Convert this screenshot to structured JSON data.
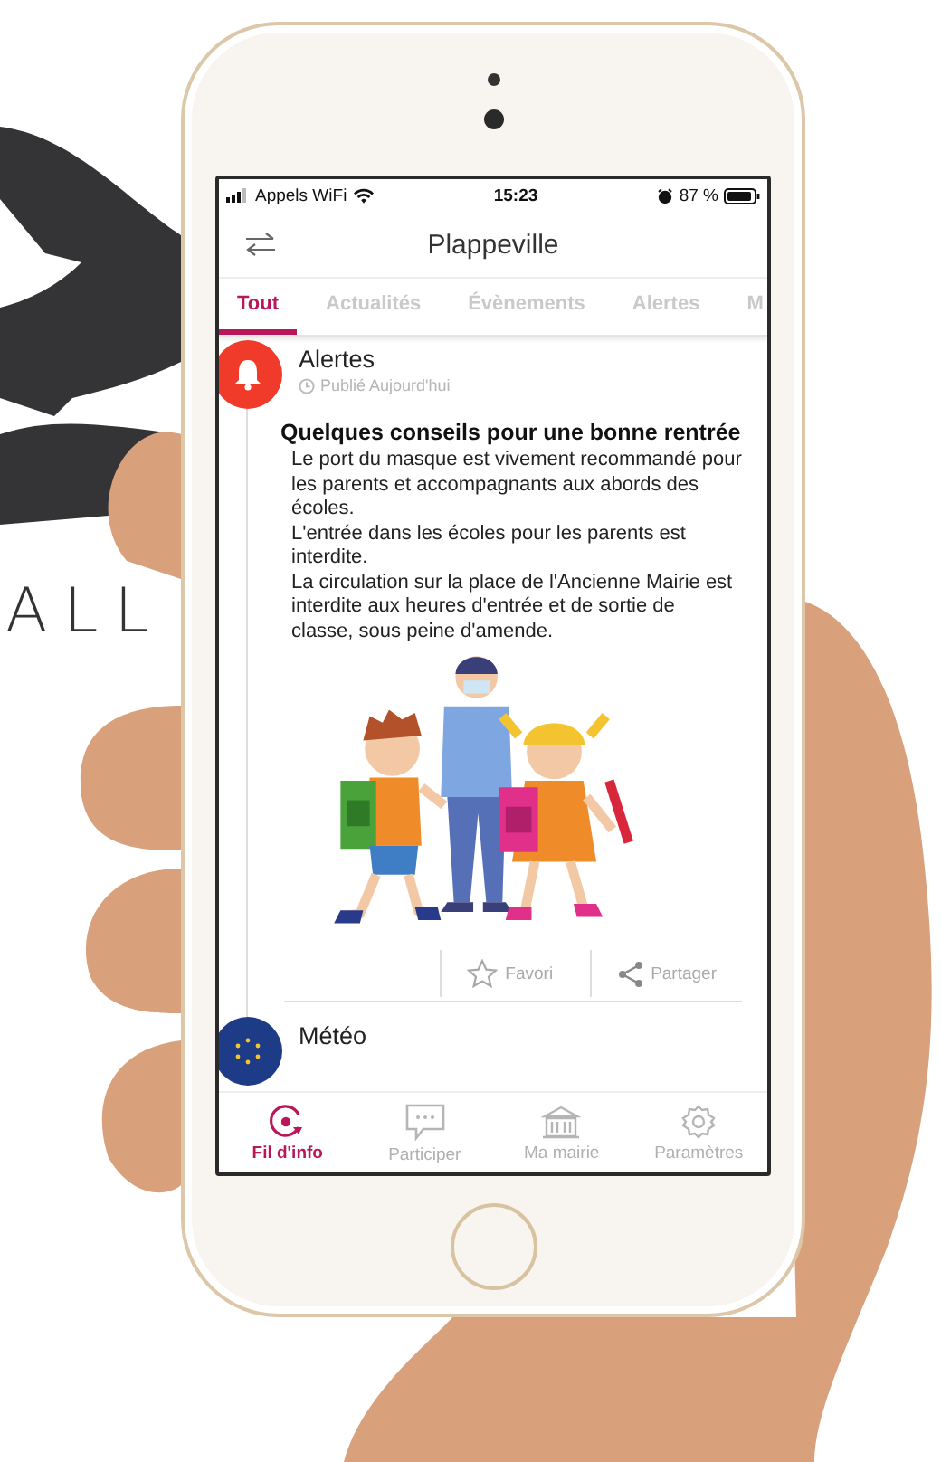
{
  "logo": {
    "text": "ALL"
  },
  "status_bar": {
    "carrier": "Appels WiFi",
    "time": "15:23",
    "battery": "87 %"
  },
  "header": {
    "title": "Plappeville"
  },
  "tabs": [
    {
      "label": "Tout",
      "selected": true
    },
    {
      "label": "Actualités",
      "selected": false
    },
    {
      "label": "Évènements",
      "selected": false
    },
    {
      "label": "Alertes",
      "selected": false
    },
    {
      "label": "M",
      "selected": false
    }
  ],
  "feed": [
    {
      "kind": "alert",
      "category": "Alertes",
      "published": "Publié Aujourd'hui",
      "title": "Quelques conseils pour une bonne rentrée",
      "paragraphs": [
        "Le port du masque est vivement recommandé pour les parents et accompagnants aux abords des écoles.",
        "L'entrée dans les écoles pour les parents est interdite.",
        "La circulation sur la place de l'Ancienne Mairie est interdite aux heures d'entrée et de sortie de classe, sous peine d'amende."
      ],
      "actions": [
        {
          "kind": "favorite",
          "label": "Favori"
        },
        {
          "kind": "share",
          "label": "Partager"
        }
      ]
    },
    {
      "kind": "weather",
      "category": "Météo"
    }
  ],
  "bottom_nav": [
    {
      "kind": "feed",
      "label": "Fil d'info",
      "selected": true
    },
    {
      "kind": "participate",
      "label": "Participer",
      "selected": false
    },
    {
      "kind": "townhall",
      "label": "Ma mairie",
      "selected": false
    },
    {
      "kind": "settings",
      "label": "Paramètres",
      "selected": false
    }
  ]
}
